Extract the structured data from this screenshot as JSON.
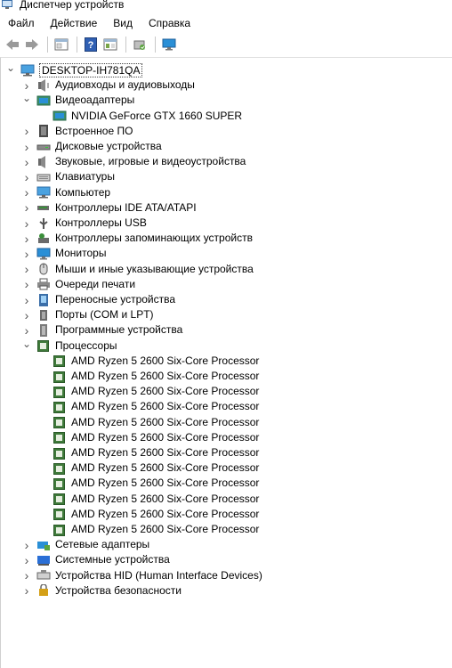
{
  "window": {
    "title": "Диспетчер устройств"
  },
  "menu": [
    "Файл",
    "Действие",
    "Вид",
    "Справка"
  ],
  "toolbar": [
    "back-icon",
    "forward-icon",
    "properties-icon",
    "help-icon",
    "view-icon",
    "scan-hardware-icon",
    "monitor-icon"
  ],
  "root": "DESKTOP-IH781QA",
  "categories": [
    {
      "label": "Аудиовходы и аудиовыходы",
      "icon": "audio-icon",
      "expanded": false
    },
    {
      "label": "Видеоадаптеры",
      "icon": "display-adapter-icon",
      "expanded": true
    },
    {
      "label": "NVIDIA GeForce GTX 1660 SUPER",
      "icon": "display-adapter-icon",
      "child": true
    },
    {
      "label": "Встроенное ПО",
      "icon": "firmware-icon",
      "expanded": false
    },
    {
      "label": "Дисковые устройства",
      "icon": "disk-icon",
      "expanded": false
    },
    {
      "label": "Звуковые, игровые и видеоустройства",
      "icon": "sound-icon",
      "expanded": false
    },
    {
      "label": "Клавиатуры",
      "icon": "keyboard-icon",
      "expanded": false
    },
    {
      "label": "Компьютер",
      "icon": "computer-icon",
      "expanded": false
    },
    {
      "label": "Контроллеры IDE ATA/ATAPI",
      "icon": "ide-icon",
      "expanded": false
    },
    {
      "label": "Контроллеры USB",
      "icon": "usb-icon",
      "expanded": false
    },
    {
      "label": "Контроллеры запоминающих устройств",
      "icon": "storage-icon",
      "expanded": false
    },
    {
      "label": "Мониторы",
      "icon": "monitor-icon",
      "expanded": false
    },
    {
      "label": "Мыши и иные указывающие устройства",
      "icon": "mouse-icon",
      "expanded": false
    },
    {
      "label": "Очереди печати",
      "icon": "printer-icon",
      "expanded": false
    },
    {
      "label": "Переносные устройства",
      "icon": "portable-icon",
      "expanded": false
    },
    {
      "label": "Порты (COM и LPT)",
      "icon": "port-icon",
      "expanded": false
    },
    {
      "label": "Программные устройства",
      "icon": "software-device-icon",
      "expanded": false
    },
    {
      "label": "Процессоры",
      "icon": "processor-icon",
      "expanded": true
    },
    {
      "label": "AMD Ryzen 5 2600 Six-Core Processor",
      "icon": "processor-icon",
      "child": true
    },
    {
      "label": "AMD Ryzen 5 2600 Six-Core Processor",
      "icon": "processor-icon",
      "child": true
    },
    {
      "label": "AMD Ryzen 5 2600 Six-Core Processor",
      "icon": "processor-icon",
      "child": true
    },
    {
      "label": "AMD Ryzen 5 2600 Six-Core Processor",
      "icon": "processor-icon",
      "child": true
    },
    {
      "label": "AMD Ryzen 5 2600 Six-Core Processor",
      "icon": "processor-icon",
      "child": true
    },
    {
      "label": "AMD Ryzen 5 2600 Six-Core Processor",
      "icon": "processor-icon",
      "child": true
    },
    {
      "label": "AMD Ryzen 5 2600 Six-Core Processor",
      "icon": "processor-icon",
      "child": true
    },
    {
      "label": "AMD Ryzen 5 2600 Six-Core Processor",
      "icon": "processor-icon",
      "child": true
    },
    {
      "label": "AMD Ryzen 5 2600 Six-Core Processor",
      "icon": "processor-icon",
      "child": true
    },
    {
      "label": "AMD Ryzen 5 2600 Six-Core Processor",
      "icon": "processor-icon",
      "child": true
    },
    {
      "label": "AMD Ryzen 5 2600 Six-Core Processor",
      "icon": "processor-icon",
      "child": true
    },
    {
      "label": "AMD Ryzen 5 2600 Six-Core Processor",
      "icon": "processor-icon",
      "child": true
    },
    {
      "label": "Сетевые адаптеры",
      "icon": "network-icon",
      "expanded": false
    },
    {
      "label": "Системные устройства",
      "icon": "system-devices-icon",
      "expanded": false
    },
    {
      "label": "Устройства HID (Human Interface Devices)",
      "icon": "hid-icon",
      "expanded": false
    },
    {
      "label": "Устройства безопасности",
      "icon": "security-icon",
      "expanded": false
    }
  ],
  "colors": {
    "processor": "#3f7a3a",
    "monitor": "#2a8fd6",
    "selection_border": "#444444"
  }
}
